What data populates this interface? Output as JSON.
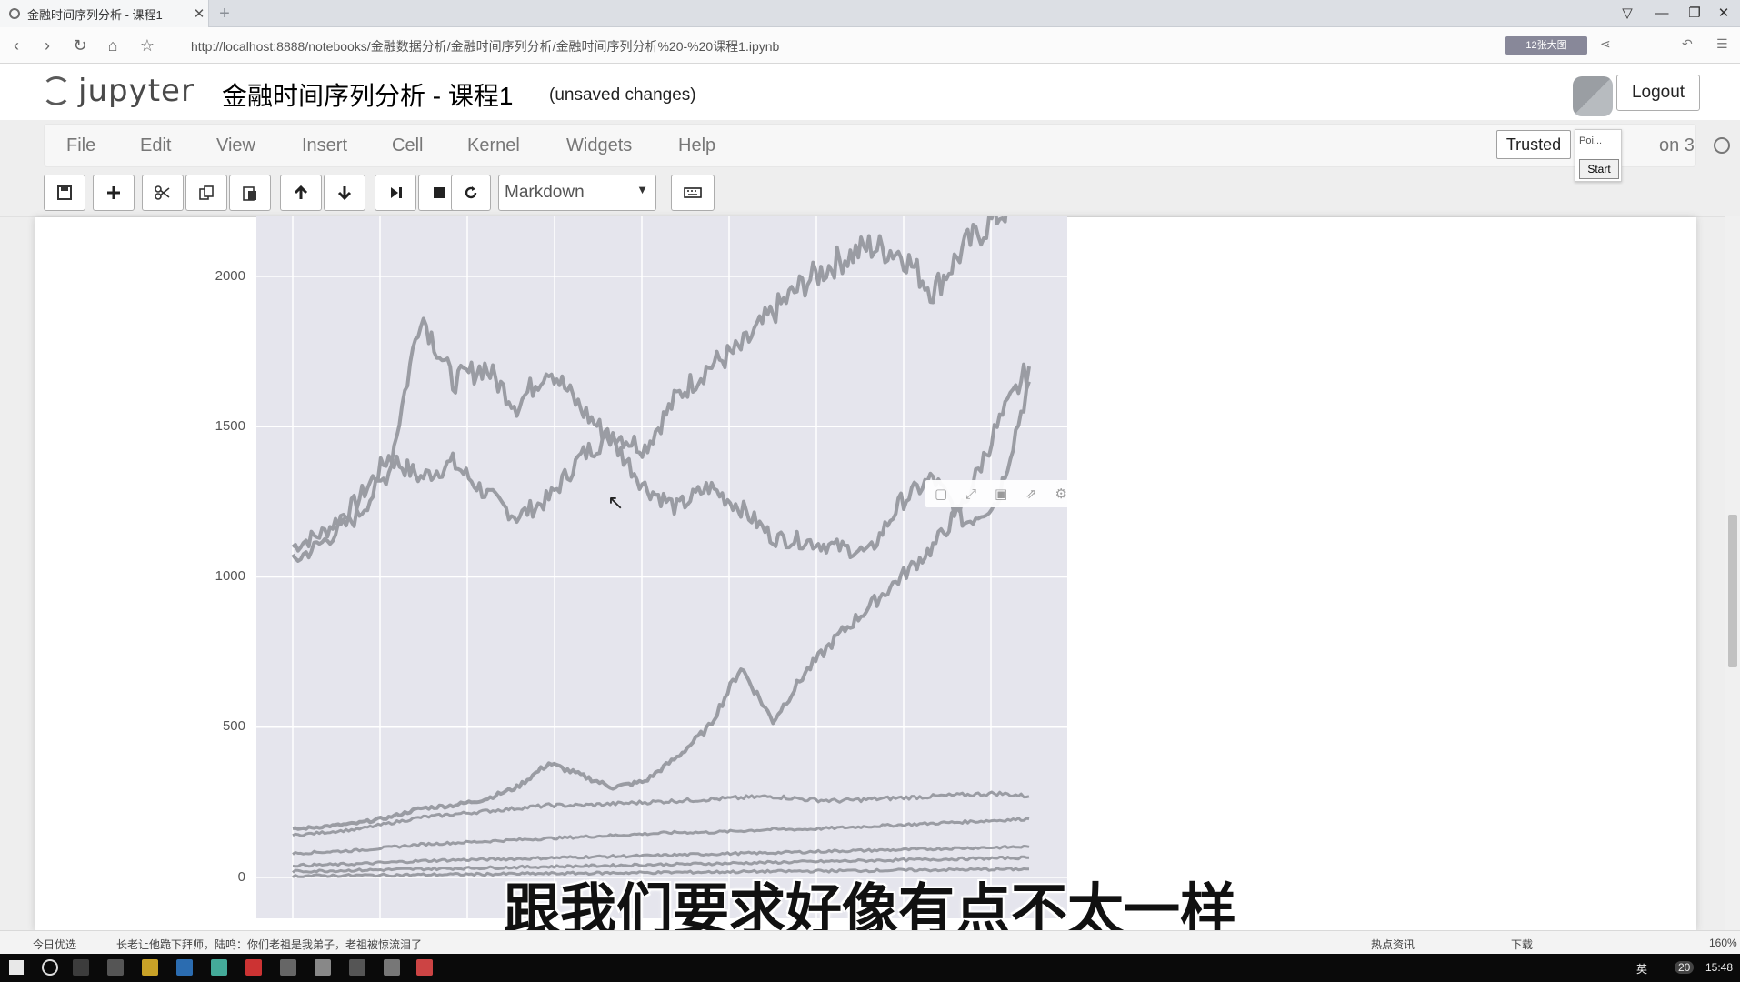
{
  "browser": {
    "tab_title": "金融时间序列分析 - 课程1",
    "tab_close": "✕",
    "new_tab": "+",
    "url": "http://localhost:8888/notebooks/金融数据分析/金融时间序列分析/金融时间序列分析%20-%20课程1.ipynb",
    "promo": "12张大图",
    "win_controls": [
      "▽",
      "—",
      "❐",
      "✕"
    ]
  },
  "jupyter": {
    "logo_text": "jupyter",
    "notebook_title": "金融时间序列分析 - 课程1",
    "unsaved": "(unsaved changes)",
    "logout": "Logout",
    "menu": [
      "File",
      "Edit",
      "View",
      "Insert",
      "Cell",
      "Kernel",
      "Widgets",
      "Help"
    ],
    "trusted": "Trusted",
    "kernel": "on 3",
    "popup_text": "Poi...",
    "popup_start": "Start",
    "cell_type": "Markdown"
  },
  "toolbar_icons": [
    "save-icon",
    "plus-icon",
    "scissors-icon",
    "copy-icon",
    "paste-icon",
    "arrow-up-icon",
    "arrow-down-icon",
    "step-forward-icon",
    "stop-icon",
    "restart-icon",
    "keyboard-icon"
  ],
  "chart_data": {
    "type": "line",
    "title": "",
    "xlabel": "",
    "ylabel": "",
    "y_ticks": [
      "2000",
      "1500",
      "1000",
      "500",
      "0"
    ],
    "ylim": [
      -150,
      2300
    ],
    "series": [
      {
        "values": [
          1100,
          1150,
          1250,
          1400,
          1330,
          1380,
          1280,
          1200,
          1260,
          1400,
          1480,
          1430,
          1600,
          1700,
          1760,
          1880,
          1980,
          2050,
          2100,
          2080,
          1950,
          2100,
          2200,
          2280
        ]
      },
      {
        "values": [
          1050,
          1120,
          1200,
          1350,
          1880,
          1650,
          1700,
          1570,
          1700,
          1560,
          1450,
          1300,
          1230,
          1300,
          1230,
          1130,
          1120,
          1100,
          1080,
          1250,
          1330,
          1180,
          1250,
          1650
        ]
      },
      {
        "values": [
          160,
          170,
          180,
          200,
          230,
          240,
          260,
          300,
          380,
          340,
          300,
          320,
          400,
          500,
          700,
          520,
          680,
          800,
          900,
          1000,
          1100,
          1250,
          1500,
          1700
        ]
      },
      {
        "values": [
          140,
          150,
          160,
          180,
          200,
          210,
          220,
          230,
          240,
          240,
          245,
          250,
          255,
          260,
          265,
          270,
          260,
          255,
          260,
          265,
          270,
          275,
          280,
          270
        ]
      },
      {
        "values": [
          80,
          85,
          90,
          100,
          110,
          115,
          120,
          125,
          130,
          135,
          140,
          145,
          150,
          150,
          155,
          160,
          160,
          165,
          170,
          175,
          180,
          185,
          190,
          195
        ]
      },
      {
        "values": [
          40,
          42,
          45,
          50,
          55,
          58,
          60,
          62,
          65,
          68,
          70,
          72,
          75,
          78,
          80,
          82,
          85,
          88,
          90,
          92,
          95,
          98,
          100,
          102
        ]
      },
      {
        "values": [
          20,
          22,
          24,
          26,
          28,
          30,
          32,
          34,
          36,
          38,
          40,
          42,
          44,
          46,
          48,
          50,
          52,
          54,
          56,
          58,
          60,
          62,
          64,
          66
        ]
      },
      {
        "values": [
          5,
          6,
          7,
          8,
          9,
          10,
          11,
          12,
          13,
          14,
          15,
          16,
          17,
          18,
          19,
          20,
          21,
          22,
          23,
          24,
          25,
          26,
          27,
          28
        ]
      }
    ]
  },
  "modebar_icons": [
    "camera-icon",
    "expand-icon",
    "save-plot-icon",
    "share-icon",
    "gear-icon"
  ],
  "subtitle": "跟我们要求好像有点不太一样",
  "statusbar": {
    "left": "今日优选",
    "news": "长老让他跪下拜师，陆鸣：你们老祖是我弟子，老祖被惊流泪了",
    "hot": "热点资讯",
    "download": "下载",
    "zoom": "160%"
  },
  "taskbar": {
    "ime": "英",
    "time": "15:48",
    "badge": "20"
  }
}
